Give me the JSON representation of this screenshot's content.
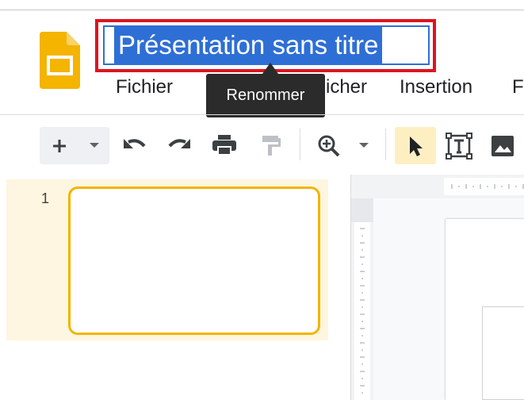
{
  "document": {
    "title": "Présentation sans titre"
  },
  "menu": {
    "items": [
      {
        "label": "Fichier"
      },
      {
        "label": "icher"
      },
      {
        "label": "Insertion"
      },
      {
        "label": "F"
      }
    ]
  },
  "tooltip": {
    "text": "Renommer"
  },
  "toolbar": {
    "icons": [
      "plus-icon",
      "dropdown-arrow-icon",
      "undo-icon",
      "redo-icon",
      "print-icon",
      "paint-format-icon",
      "zoom-icon",
      "zoom-dropdown-icon",
      "select-cursor-icon",
      "text-box-icon",
      "image-icon"
    ]
  },
  "filmstrip": {
    "slides": [
      {
        "number": "1"
      }
    ]
  },
  "colors": {
    "highlight_box": "#e0131f",
    "title_selection": "#2e6fd6",
    "brand_yellow": "#f4b400",
    "active_tool_bg": "#feefc3",
    "tooltip_bg": "#2b2b2b"
  }
}
